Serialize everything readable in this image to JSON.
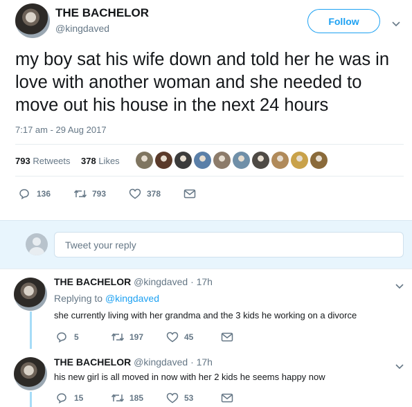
{
  "tweet": {
    "author_name": "THE BACHELOR",
    "author_handle": "@kingdaved",
    "follow_label": "Follow",
    "text": "my boy sat his wife down and told her he was in love with another woman and she needed to move out his house in the next 24 hours",
    "timestamp": "7:17 am - 29 Aug 2017",
    "retweets_count": "793",
    "retweets_label": "Retweets",
    "likes_count": "378",
    "likes_label": "Likes",
    "liker_avatar_colors": [
      "#7f7560",
      "#5a3a2a",
      "#3b3b3b",
      "#5a7fa8",
      "#8c7b6a",
      "#6f8fa8",
      "#4e4a45",
      "#b08a5a",
      "#c9a24a",
      "#8a6a3a"
    ],
    "actions": {
      "replies": "136",
      "retweets": "793",
      "likes": "378"
    }
  },
  "reply_composer": {
    "placeholder": "Tweet your reply"
  },
  "replies": [
    {
      "author_name": "THE BACHELOR",
      "author_handle": "@kingdaved",
      "time": "· 17h",
      "replying_prefix": "Replying to",
      "replying_to": "@kingdaved",
      "text": "she currently living with her grandma and the 3 kids he working on a divorce",
      "replies": "5",
      "retweets": "197",
      "likes": "45"
    },
    {
      "author_name": "THE BACHELOR",
      "author_handle": "@kingdaved",
      "time": "· 17h",
      "text": "his new girl is all moved in now with her 2 kids he seems happy now",
      "replies": "15",
      "retweets": "185",
      "likes": "53"
    }
  ],
  "colors": {
    "accent": "#1da1f2",
    "muted": "#657786",
    "thread_line": "#a6dcf7"
  }
}
